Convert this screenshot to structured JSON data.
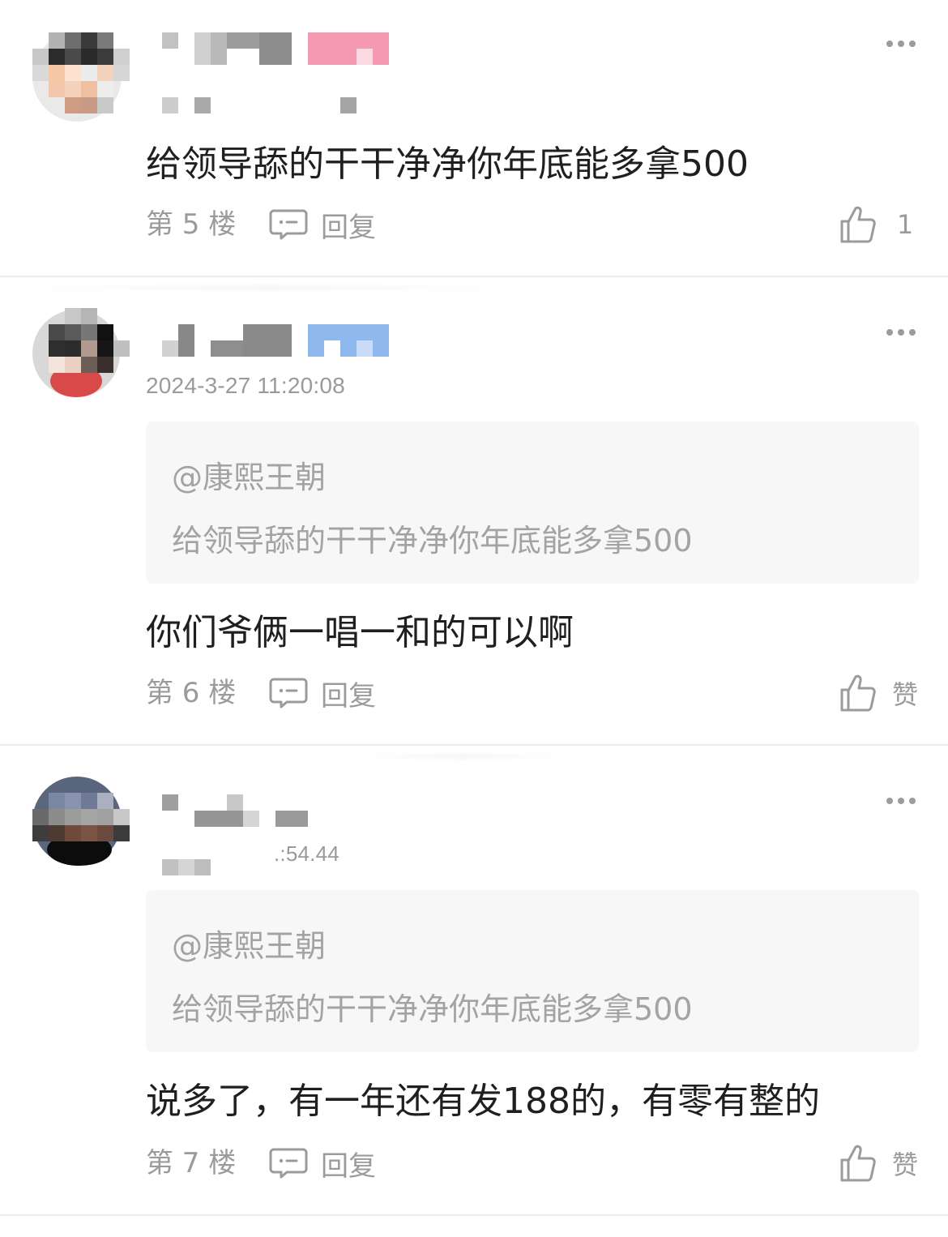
{
  "comments": [
    {
      "timestamp": "",
      "content": "给领导舔的干干净净你年底能多拿500",
      "floor": "第 5 楼",
      "reply_label": "回复",
      "like_label": "1",
      "quote": null
    },
    {
      "timestamp": "2024-3-27 11:20:08",
      "content": "你们爷俩一唱一和的可以啊",
      "floor": "第 6 楼",
      "reply_label": "回复",
      "like_label": "赞",
      "quote": {
        "mention": "@康熙王朝",
        "text": "给领导舔的干干净净你年底能多拿500"
      }
    },
    {
      "timestamp": ".:54.44",
      "content": "说多了，有一年还有发188的，有零有整的",
      "floor": "第 7 楼",
      "reply_label": "回复",
      "like_label": "赞",
      "quote": {
        "mention": "@康熙王朝",
        "text": "给领导舔的干干净净你年底能多拿500"
      }
    }
  ],
  "icons": {
    "more": "more-dots-icon",
    "reply": "comment-bubble-icon",
    "like": "thumbs-up-icon"
  },
  "colors": {
    "background": "#ffffff",
    "secondary_text": "#9b9b9b",
    "quote_background": "#f7f7f7",
    "username_badge_pink": "#f59ab2",
    "username_badge_blue": "#8fb8ee"
  }
}
